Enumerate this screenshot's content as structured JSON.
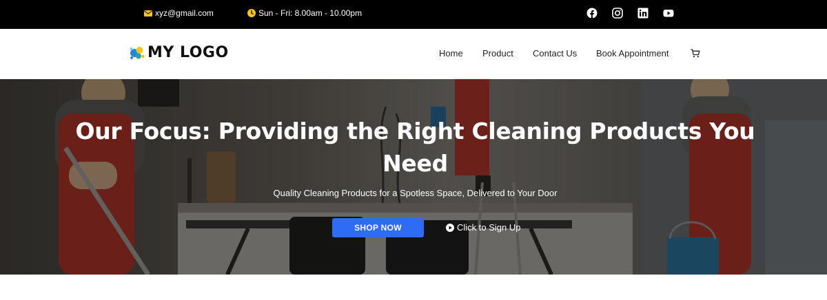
{
  "topbar": {
    "email": "xyz@gmail.com",
    "hours": "Sun - Fri: 8.00am - 10.00pm",
    "email_icon": "envelope-icon",
    "hours_icon": "clock-icon",
    "social": [
      "facebook-icon",
      "instagram-icon",
      "linkedin-icon",
      "youtube-icon"
    ]
  },
  "header": {
    "logo_text": "MY LOGO",
    "nav": [
      "Home",
      "Product",
      "Contact Us",
      "Book Appointment"
    ],
    "cart_icon": "cart-icon"
  },
  "hero": {
    "title": "Our Focus: Providing the Right Cleaning Products You Need",
    "subtitle": "Quality Cleaning Products for a Spotless Space, Delivered to Your Door",
    "primary_button": "SHOP NOW",
    "secondary_link": "Click to Sign Up",
    "secondary_icon": "play-icon"
  },
  "colors": {
    "topbar_bg": "#000000",
    "accent_button": "#2e6cf6",
    "icon_yellow": "#f5c518",
    "worker_uniform": "#c0392b"
  }
}
